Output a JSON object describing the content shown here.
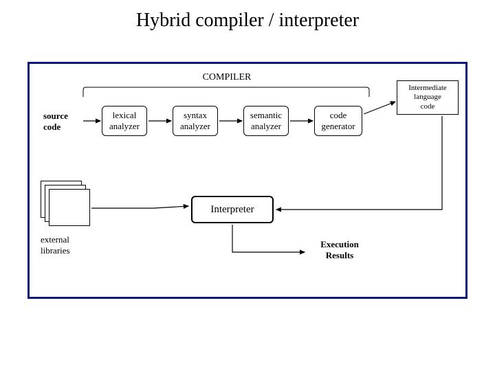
{
  "title": "Hybrid compiler / interpreter",
  "labels": {
    "compiler": "COMPILER",
    "source": "source\ncode",
    "lexical": "lexical\nanalyzer",
    "syntax": "syntax\nanalyzer",
    "semantic": "semantic\nanalyzer",
    "codegen": "code\ngenerator",
    "intermediate": "Intermediate\nlanguage\ncode",
    "interpreter": "Interpreter",
    "external": "external\nlibraries",
    "results": "Execution\nResults"
  }
}
